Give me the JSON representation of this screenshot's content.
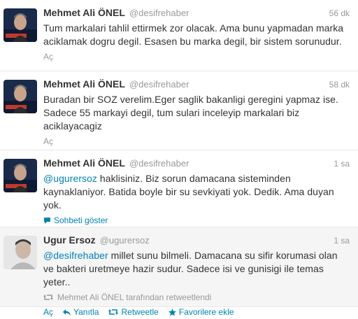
{
  "tweets": [
    {
      "fullname": "Mehmet Ali ÖNEL",
      "username": "@desifrehaber",
      "time": "56 dk",
      "text": "Tum markalari tahlil ettirmek zor olacak. Ama bunu yapmadan marka aciklamak dogru degil. Esasen bu marka degil, bir sistem sorunudur.",
      "expand_label": "Aç"
    },
    {
      "fullname": "Mehmet Ali ÖNEL",
      "username": "@desifrehaber",
      "time": "58 dk",
      "text": "Buradan bir SOZ verelim.Eger saglik bakanligi geregini yapmaz ise. Sadece 55 markayi degil, tum sulari inceleyip markalari biz aciklayacagiz",
      "expand_label": "Aç"
    },
    {
      "fullname": "Mehmet Ali ÖNEL",
      "username": "@desifrehaber",
      "time": "1 sa",
      "mention": "@ugurersoz",
      "text": " haklisiniz. Biz sorun damacana sisteminden kaynaklaniyor. Batida boyle bir su sevkiyati yok. Dedik. Ama duyan yok.",
      "conversation_label": "Sohbeti göster"
    },
    {
      "fullname": "Ugur Ersoz",
      "username": "@ugurersoz",
      "time": "1 sa",
      "mention": "@desifrehaber",
      "text": " millet sunu bilmeli. Damacana su sifir korumasi olan ve bakteri uretmeye hazir sudur. Sadece isi ve gunisigi ile temas yeter..",
      "retweeted_by": "Mehmet Ali ÖNEL tarafından retweetlendi",
      "expand_label": "Aç",
      "reply_label": "Yanıtla",
      "retweet_label": "Retweetle",
      "favorite_label": "Favorilere ekle"
    }
  ],
  "colors": {
    "link": "#0084b4",
    "muted": "#999999",
    "text": "#333333",
    "highlight_bg": "#f5f5f5"
  }
}
